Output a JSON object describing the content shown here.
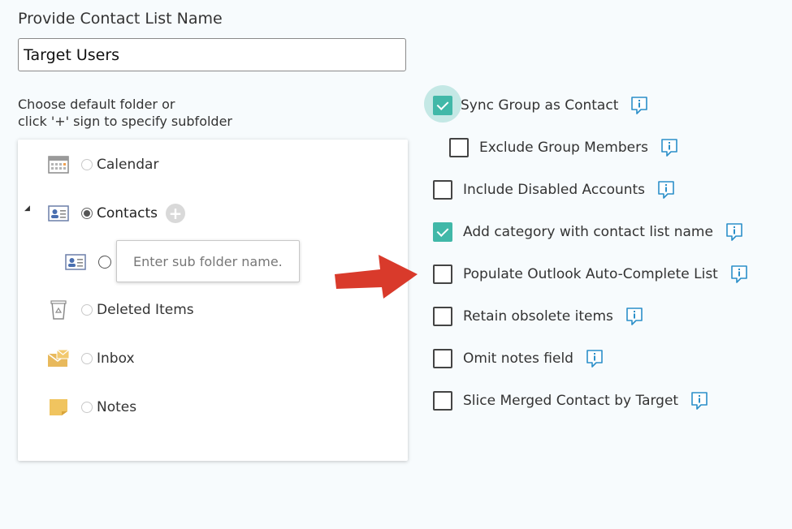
{
  "form": {
    "title": "Provide Contact List Name",
    "list_name_value": "Target Users",
    "hint_line1": "Choose default folder or",
    "hint_line2": "click '+' sign to specify subfolder"
  },
  "folders": [
    {
      "label": "Calendar",
      "icon": "calendar-icon",
      "selected": false
    },
    {
      "label": "Contacts",
      "icon": "contact-card-icon",
      "selected": true,
      "expanded": true
    },
    {
      "label": "Deleted Items",
      "icon": "trash-bin-icon",
      "selected": false
    },
    {
      "label": "Inbox",
      "icon": "inbox-icon",
      "selected": false
    },
    {
      "label": "Notes",
      "icon": "note-icon",
      "selected": false
    }
  ],
  "subfolder": {
    "placeholder": "Enter sub folder name."
  },
  "options": [
    {
      "label": "Sync Group as Contact",
      "checked": true
    },
    {
      "label": "Exclude Group Members",
      "checked": false
    },
    {
      "label": "Include Disabled Accounts",
      "checked": false
    },
    {
      "label": "Add category with contact list name",
      "checked": true
    },
    {
      "label": "Populate Outlook Auto-Complete List",
      "checked": false
    },
    {
      "label": "Retain obsolete items",
      "checked": false
    },
    {
      "label": "Omit notes field",
      "checked": false
    },
    {
      "label": "Slice Merged Contact by Target",
      "checked": false
    }
  ],
  "colors": {
    "accent": "#41b8a8",
    "info_icon": "#2b8fc9",
    "arrow": "#d93a2b"
  }
}
